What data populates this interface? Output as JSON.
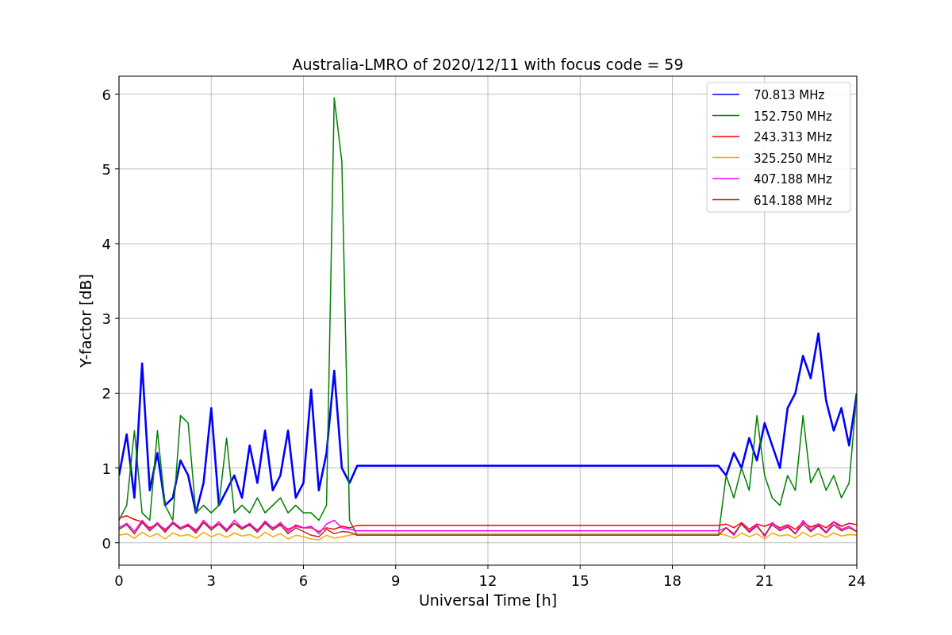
{
  "chart_data": {
    "type": "line",
    "title": "Australia-LMRO of 2020/12/11 with focus code = 59",
    "xlabel": "Universal Time [h]",
    "ylabel": "Y-factor [dB]",
    "x": [
      0,
      0.25,
      0.5,
      0.75,
      1,
      1.25,
      1.5,
      1.75,
      2,
      2.25,
      2.5,
      2.75,
      3,
      3.25,
      3.5,
      3.75,
      4,
      4.25,
      4.5,
      4.75,
      5,
      5.25,
      5.5,
      5.75,
      6,
      6.25,
      6.5,
      6.75,
      7,
      7.25,
      7.5,
      7.75,
      19.5,
      19.75,
      20,
      20.25,
      20.5,
      20.75,
      21,
      21.25,
      21.5,
      21.75,
      22,
      22.25,
      22.5,
      22.75,
      23,
      23.25,
      23.5,
      23.75,
      24
    ],
    "series": [
      {
        "name": "70.813 MHz",
        "color": "#0000ff",
        "values": [
          0.9,
          1.45,
          0.6,
          2.4,
          0.7,
          1.2,
          0.5,
          0.6,
          1.1,
          0.9,
          0.4,
          0.8,
          1.8,
          0.5,
          0.7,
          0.9,
          0.6,
          1.3,
          0.8,
          1.5,
          0.7,
          0.9,
          1.5,
          0.6,
          0.8,
          2.05,
          0.7,
          1.2,
          2.3,
          1.0,
          0.8,
          1.03,
          1.03,
          0.9,
          1.2,
          1.0,
          1.4,
          1.1,
          1.6,
          1.3,
          1.0,
          1.8,
          2.0,
          2.5,
          2.2,
          2.8,
          1.9,
          1.5,
          1.8,
          1.3,
          2.0
        ]
      },
      {
        "name": "152.750 MHz",
        "color": "#008000",
        "values": [
          0.3,
          0.5,
          1.5,
          0.4,
          0.3,
          1.5,
          0.5,
          0.3,
          1.7,
          1.6,
          0.4,
          0.5,
          0.4,
          0.5,
          1.4,
          0.4,
          0.5,
          0.4,
          0.6,
          0.4,
          0.5,
          0.6,
          0.4,
          0.5,
          0.4,
          0.4,
          0.3,
          0.5,
          5.95,
          5.1,
          0.3,
          0.1,
          0.1,
          0.9,
          0.6,
          1.0,
          0.7,
          1.7,
          0.9,
          0.6,
          0.5,
          0.9,
          0.7,
          1.7,
          0.8,
          1.0,
          0.7,
          0.9,
          0.6,
          0.8,
          2.0
        ]
      },
      {
        "name": "243.313 MHz",
        "color": "#ff0000",
        "values": [
          0.33,
          0.36,
          0.31,
          0.28,
          0.2,
          0.25,
          0.18,
          0.26,
          0.2,
          0.24,
          0.17,
          0.27,
          0.2,
          0.25,
          0.18,
          0.26,
          0.2,
          0.24,
          0.17,
          0.27,
          0.2,
          0.25,
          0.18,
          0.22,
          0.2,
          0.2,
          0.15,
          0.2,
          0.18,
          0.22,
          0.2,
          0.23,
          0.23,
          0.25,
          0.2,
          0.27,
          0.18,
          0.25,
          0.22,
          0.26,
          0.2,
          0.24,
          0.18,
          0.27,
          0.21,
          0.25,
          0.2,
          0.28,
          0.22,
          0.26,
          0.24
        ]
      },
      {
        "name": "325.250 MHz",
        "color": "#ffa500",
        "values": [
          0.1,
          0.12,
          0.06,
          0.14,
          0.08,
          0.12,
          0.05,
          0.13,
          0.09,
          0.11,
          0.06,
          0.14,
          0.08,
          0.12,
          0.07,
          0.13,
          0.09,
          0.11,
          0.06,
          0.14,
          0.08,
          0.12,
          0.05,
          0.1,
          0.08,
          0.05,
          0.04,
          0.1,
          0.06,
          0.08,
          0.1,
          0.12,
          0.12,
          0.1,
          0.06,
          0.13,
          0.08,
          0.12,
          0.05,
          0.13,
          0.09,
          0.11,
          0.06,
          0.14,
          0.08,
          0.12,
          0.07,
          0.13,
          0.09,
          0.11,
          0.1
        ]
      },
      {
        "name": "407.188 MHz",
        "color": "#ff00ff",
        "values": [
          0.2,
          0.26,
          0.15,
          0.3,
          0.18,
          0.27,
          0.16,
          0.28,
          0.2,
          0.25,
          0.15,
          0.3,
          0.19,
          0.28,
          0.17,
          0.3,
          0.2,
          0.26,
          0.16,
          0.29,
          0.19,
          0.27,
          0.15,
          0.24,
          0.2,
          0.22,
          0.12,
          0.25,
          0.3,
          0.2,
          0.18,
          0.16,
          0.16,
          0.2,
          0.1,
          0.26,
          0.15,
          0.24,
          0.08,
          0.27,
          0.18,
          0.23,
          0.12,
          0.3,
          0.17,
          0.25,
          0.14,
          0.28,
          0.18,
          0.22,
          0.15
        ]
      },
      {
        "name": "614.188 MHz",
        "color": "#a52a2a",
        "values": [
          0.18,
          0.24,
          0.12,
          0.27,
          0.16,
          0.25,
          0.14,
          0.26,
          0.18,
          0.23,
          0.13,
          0.27,
          0.17,
          0.25,
          0.15,
          0.26,
          0.18,
          0.24,
          0.14,
          0.26,
          0.17,
          0.24,
          0.12,
          0.2,
          0.15,
          0.1,
          0.08,
          0.18,
          0.12,
          0.15,
          0.14,
          0.1,
          0.1,
          0.2,
          0.12,
          0.25,
          0.14,
          0.22,
          0.1,
          0.24,
          0.16,
          0.21,
          0.12,
          0.25,
          0.15,
          0.23,
          0.13,
          0.24,
          0.16,
          0.2,
          0.15
        ]
      }
    ],
    "xlim": [
      0,
      24
    ],
    "ylim": [
      -0.3,
      6.24
    ],
    "xticks": [
      0,
      3,
      6,
      9,
      12,
      15,
      18,
      21,
      24
    ],
    "yticks": [
      0,
      1,
      2,
      3,
      4,
      5,
      6
    ],
    "grid": true,
    "legend": true
  }
}
